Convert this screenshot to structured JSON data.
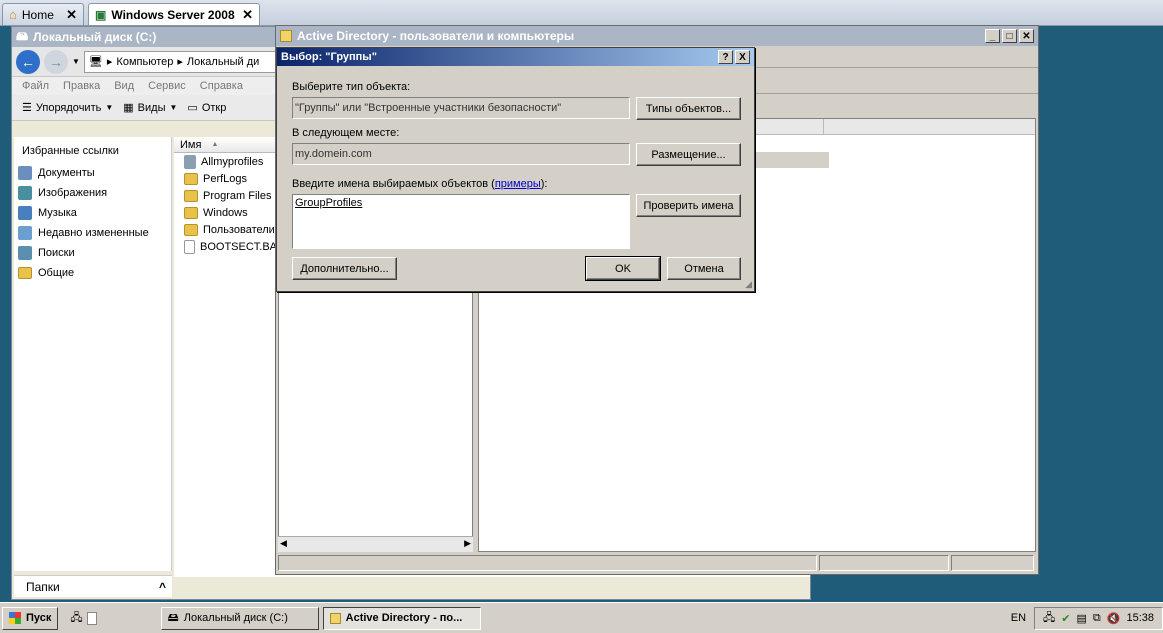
{
  "host_tabs": [
    {
      "label": "Home"
    },
    {
      "label": "Windows Server 2008"
    }
  ],
  "explorer": {
    "title": "Локальный диск (C:)",
    "address": {
      "part1": "Компьютер",
      "part2": "Локальный ди"
    },
    "menu": [
      "Файл",
      "Правка",
      "Вид",
      "Сервис",
      "Справка"
    ],
    "toolbar": {
      "organize": "Упорядочить",
      "views": "Виды",
      "open": "Откр"
    },
    "favorites_title": "Избранные ссылки",
    "favorites": [
      "Документы",
      "Изображения",
      "Музыка",
      "Недавно измененные",
      "Поиски",
      "Общие"
    ],
    "column_name": "Имя",
    "files": [
      "Allmyprofiles",
      "PerfLogs",
      "Program Files",
      "Windows",
      "Пользователи",
      "BOOTSECT.BAK"
    ],
    "folders_label": "Папки"
  },
  "ad_window": {
    "title": "Active Directory - пользователи и компьютеры"
  },
  "dialog": {
    "title": "Выбор: \"Группы\"",
    "help_btn": "?",
    "close_btn": "X",
    "object_type_label": "Выберите тип объекта:",
    "object_type_value": "\"Группы\" или \"Встроенные участники безопасности\"",
    "object_types_btn": "Типы объектов...",
    "location_label": "В следующем месте:",
    "location_value": "my.domein.com",
    "location_btn": "Размещение...",
    "names_label_prefix": "Введите имена выбираемых объектов (",
    "names_label_link": "примеры",
    "names_label_suffix": "):",
    "names_value": "GroupProfiles",
    "check_names_btn": "Проверить имена",
    "advanced_btn": "Дополнительно...",
    "ok_btn": "OK",
    "cancel_btn": "Отмена"
  },
  "taskbar": {
    "start": "Пуск",
    "tasks": [
      "Локальный диск (C:)",
      "Active Directory - по..."
    ],
    "lang": "EN",
    "clock": "15:38"
  }
}
